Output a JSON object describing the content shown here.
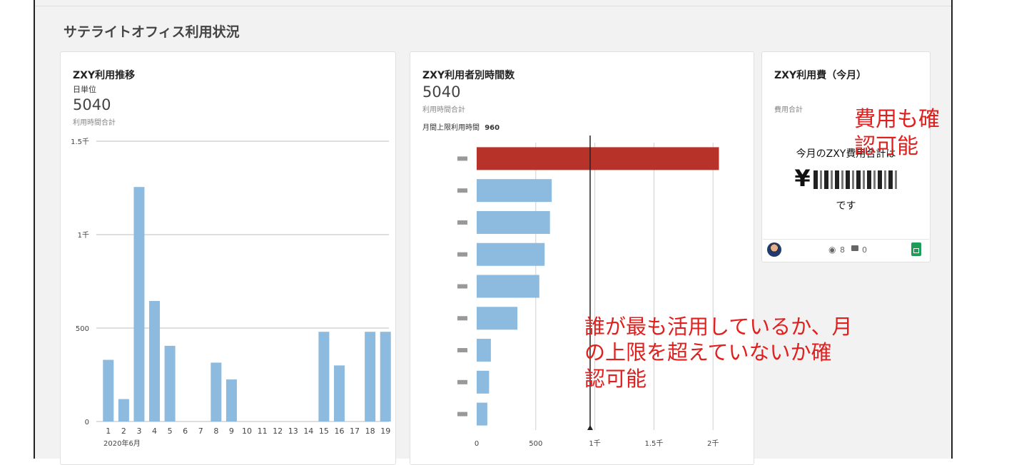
{
  "section_title": "サテライトオフィス利用状況",
  "card1": {
    "title": "ZXY利用推移",
    "subtitle": "日単位",
    "total": "5040",
    "total_label": "利用時間合計",
    "chart_data": {
      "type": "bar",
      "categories": [
        "1",
        "2",
        "3",
        "4",
        "5",
        "6",
        "7",
        "8",
        "9",
        "10",
        "11",
        "12",
        "13",
        "14",
        "15",
        "16",
        "17",
        "18",
        "19"
      ],
      "values": [
        330,
        120,
        1255,
        645,
        405,
        0,
        0,
        315,
        225,
        0,
        0,
        0,
        0,
        0,
        480,
        300,
        0,
        480,
        480
      ],
      "ylim": [
        0,
        1500
      ],
      "yticks": [
        {
          "v": 0,
          "label": "0"
        },
        {
          "v": 500,
          "label": "500"
        },
        {
          "v": 1000,
          "label": "1千"
        },
        {
          "v": 1500,
          "label": "1.5千"
        }
      ],
      "xlabel": "2020年6月",
      "color": "#8dbadf"
    }
  },
  "card2": {
    "title": "ZXY利用者別時間数",
    "total": "5040",
    "total_label": "利用時間合計",
    "limit_label": "月間上限利用時間",
    "limit_value": "960",
    "chart_data": {
      "type": "bar",
      "orientation": "horizontal",
      "values": [
        2050,
        635,
        620,
        575,
        530,
        345,
        120,
        105,
        90
      ],
      "highlight_color": "#b73228",
      "color": "#8dbadf",
      "xlim": [
        0,
        2500
      ],
      "xticks": [
        {
          "v": 0,
          "label": "0"
        },
        {
          "v": 500,
          "label": "500"
        },
        {
          "v": 1000,
          "label": "1千"
        },
        {
          "v": 1500,
          "label": "1.5千"
        },
        {
          "v": 2000,
          "label": "2千"
        },
        {
          "v": 2500,
          "label": "2.5千"
        }
      ],
      "reference_value": 960
    }
  },
  "card3": {
    "title": "ZXY利用費（今月）",
    "cost_label": "費用合計",
    "line1": "今月のZXY費用合計は",
    "amount_prefix": "¥",
    "line3": "です",
    "views": "8",
    "comments": "0"
  },
  "annotations": {
    "cost_note": "費用も確認可能",
    "usage_note_1": "誰が最も活用しているか、月",
    "usage_note_2": "の上限を超えていないか確",
    "usage_note_3": "認可能"
  }
}
